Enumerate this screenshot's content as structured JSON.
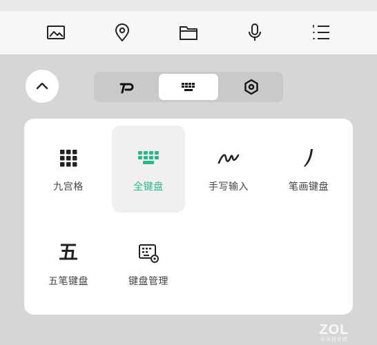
{
  "toolbar": {
    "items": [
      {
        "icon": "image-icon"
      },
      {
        "icon": "location-pin-icon"
      },
      {
        "icon": "folder-icon"
      },
      {
        "icon": "microphone-icon"
      },
      {
        "icon": "numbered-list-icon"
      }
    ]
  },
  "collapse": {
    "icon": "chevron-up-icon"
  },
  "mode_switch": {
    "items": [
      {
        "icon": "pinyin-logo-icon",
        "active": false
      },
      {
        "icon": "keyboard-icon",
        "active": true
      },
      {
        "icon": "settings-hexagon-icon",
        "active": false
      }
    ]
  },
  "keyboards": {
    "items": [
      {
        "label": "九宫格",
        "icon": "nine-grid-icon",
        "active": false
      },
      {
        "label": "全键盘",
        "icon": "full-keyboard-icon",
        "active": true
      },
      {
        "label": "手写输入",
        "icon": "handwriting-icon",
        "active": false
      },
      {
        "label": "笔画键盘",
        "icon": "stroke-icon",
        "active": false
      },
      {
        "label": "五笔键盘",
        "icon": "wubi-icon",
        "glyph": "五",
        "active": false
      },
      {
        "label": "键盘管理",
        "icon": "keyboard-settings-icon",
        "active": false
      }
    ]
  },
  "watermark": {
    "main": "ZOL",
    "sub": "中关村在线"
  },
  "colors": {
    "accent": "#2fb783",
    "background": "#d6d6d9",
    "panel": "#ffffff"
  }
}
